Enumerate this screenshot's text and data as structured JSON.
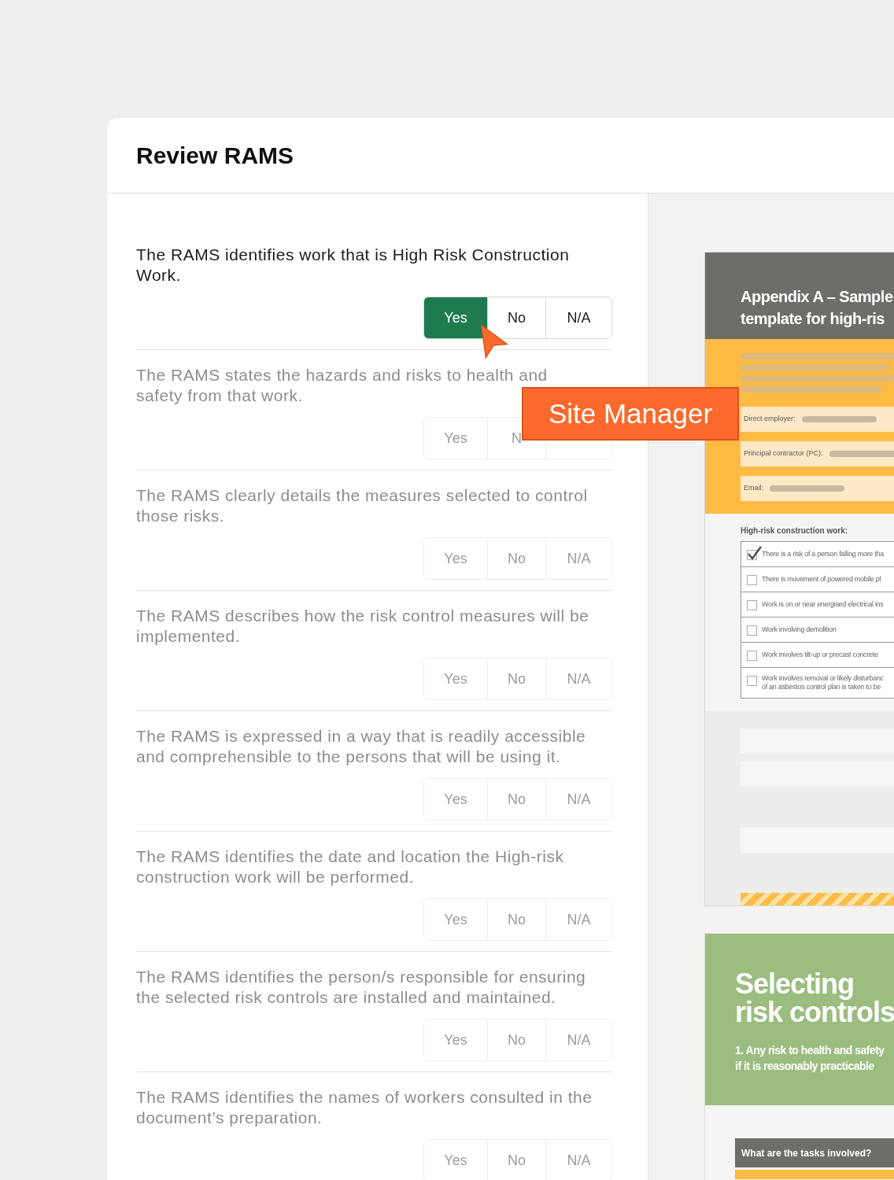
{
  "panel": {
    "title": "Review RAMS"
  },
  "questions": [
    {
      "text": "The RAMS identifies work that is High Risk Construction Work.",
      "active": true,
      "options": [
        {
          "label": "Yes",
          "selected": true
        },
        {
          "label": "No",
          "selected": false
        },
        {
          "label": "N/A",
          "selected": false
        }
      ]
    },
    {
      "text": "The RAMS states the hazards and risks to health and safety from that work.",
      "active": false,
      "options": [
        {
          "label": "Yes",
          "selected": false
        },
        {
          "label": "N",
          "selected": false
        },
        {
          "selected": false
        }
      ]
    },
    {
      "text": "The RAMS clearly details the measures selected to control those risks.",
      "active": false,
      "options": [
        {
          "label": "Yes",
          "selected": false
        },
        {
          "label": "No",
          "selected": false
        },
        {
          "label": "N/A",
          "selected": false
        }
      ]
    },
    {
      "text": "The RAMS describes how the risk control measures will be implemented.",
      "active": false,
      "options": [
        {
          "label": "Yes",
          "selected": false
        },
        {
          "label": "No",
          "selected": false
        },
        {
          "label": "N/A",
          "selected": false
        }
      ]
    },
    {
      "text": "The RAMS is expressed in a way that is readily accessible and comprehensible to the persons that will be using it.",
      "active": false,
      "options": [
        {
          "label": "Yes",
          "selected": false
        },
        {
          "label": "No",
          "selected": false
        },
        {
          "label": "N/A",
          "selected": false
        }
      ]
    },
    {
      "text": "The RAMS identifies the date and location the High-risk construction work will be performed.",
      "active": false,
      "options": [
        {
          "label": "Yes",
          "selected": false
        },
        {
          "label": "No",
          "selected": false
        },
        {
          "label": "N/A",
          "selected": false
        }
      ]
    },
    {
      "text": "The RAMS identifies the person/s responsible for ensuring the selected risk controls are installed and maintained.",
      "active": false,
      "options": [
        {
          "label": "Yes",
          "selected": false
        },
        {
          "label": "No",
          "selected": false
        },
        {
          "label": "N/A",
          "selected": false
        }
      ]
    },
    {
      "text": "The RAMS identifies the names of workers consulted in the document’s preparation.",
      "active": false,
      "options": [
        {
          "label": "Yes",
          "selected": false
        },
        {
          "label": "No",
          "selected": false
        },
        {
          "label": "N/A",
          "selected": false
        }
      ]
    }
  ],
  "cursor_label": "Site Manager",
  "document": {
    "page_1": {
      "title_lines": [
        "Appendix A – Sample",
        "template for high-ris"
      ],
      "fields": [
        "Direct employer:",
        "Principal contractor (PC):",
        "Email:"
      ],
      "section_title": "High-risk construction work:",
      "checklist": [
        {
          "lines": [
            "There is a risk of a person falling more tha"
          ],
          "checked": true
        },
        {
          "lines": [
            "There is movement of powered mobile pl"
          ],
          "checked": false
        },
        {
          "lines": [
            "Work is on or near energised electrical ins"
          ],
          "checked": false
        },
        {
          "lines": [
            "Work involving demolition"
          ],
          "checked": false
        },
        {
          "lines": [
            "Work involves tilt-up or precast concrete"
          ],
          "checked": false
        },
        {
          "lines": [
            "Work involves removal or likely disturbanc",
            "of an asbestos control plan is taken to be"
          ],
          "checked": false
        }
      ]
    },
    "page_2": {
      "title_lines": [
        "Selecting",
        "risk controls"
      ],
      "intro_lines": [
        "1. Any risk to health and safety",
        "if it is reasonably practicable"
      ],
      "table_heading": "What are the tasks involved?"
    }
  }
}
